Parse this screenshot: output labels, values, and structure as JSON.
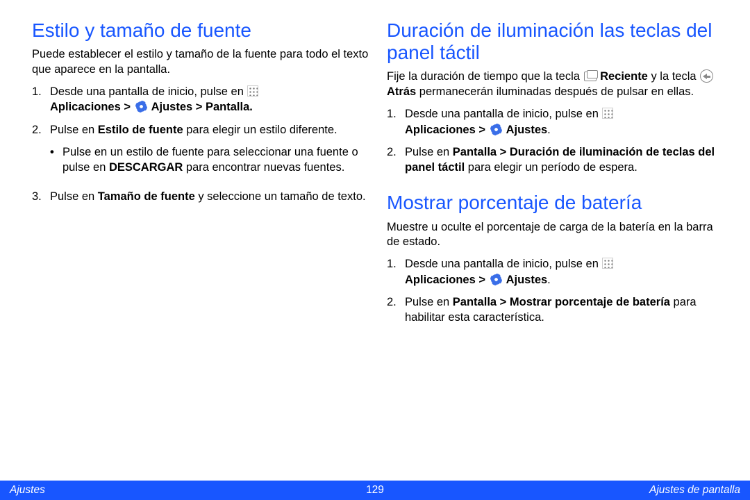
{
  "left": {
    "sec1": {
      "heading": "Estilo y tamaño de fuente",
      "intro": "Puede establecer el estilo y tamaño de la fuente para todo el texto que aparece en la pantalla.",
      "step1_a": "Desde una pantalla de inicio, pulse en ",
      "step1_b": "Aplicaciones > ",
      "step1_c": " Ajustes > Pantalla.",
      "step2_a": "Pulse en ",
      "step2_b": "Estilo de fuente",
      "step2_c": " para elegir un estilo diferente.",
      "sub1_a": "Pulse en un estilo de fuente para seleccionar una fuente o pulse en ",
      "sub1_b": "DESCARGAR",
      "sub1_c": " para encontrar nuevas fuentes.",
      "step3_a": "Pulse en ",
      "step3_b": "Tamaño de fuente",
      "step3_c": " y seleccione un tamaño de texto."
    }
  },
  "right": {
    "sec1": {
      "heading": "Duración de iluminación las teclas del panel táctil",
      "intro_a": "Fije la duración de tiempo que la tecla ",
      "intro_b": " Reciente",
      "intro_c": " y la tecla ",
      "intro_d": " Atrás",
      "intro_e": " permanecerán iluminadas después de pulsar en ellas.",
      "step1_a": "Desde una pantalla de inicio, pulse en ",
      "step1_b": "Aplicaciones > ",
      "step1_c": " Ajustes",
      "step1_d": ".",
      "step2_a": "Pulse en ",
      "step2_b": "Pantalla > Duración de iluminación de teclas del panel táctil",
      "step2_c": " para elegir un período de espera."
    },
    "sec2": {
      "heading": "Mostrar porcentaje de batería",
      "intro": "Muestre u oculte el porcentaje de carga de la batería en la barra de estado.",
      "step1_a": "Desde una pantalla de inicio, pulse en ",
      "step1_b": "Aplicaciones > ",
      "step1_c": " Ajustes",
      "step1_d": ".",
      "step2_a": "Pulse en ",
      "step2_b": "Pantalla > Mostrar porcentaje de batería",
      "step2_c": " para habilitar esta característica."
    }
  },
  "footer": {
    "left": "Ajustes",
    "page": "129",
    "right": "Ajustes de pantalla"
  }
}
